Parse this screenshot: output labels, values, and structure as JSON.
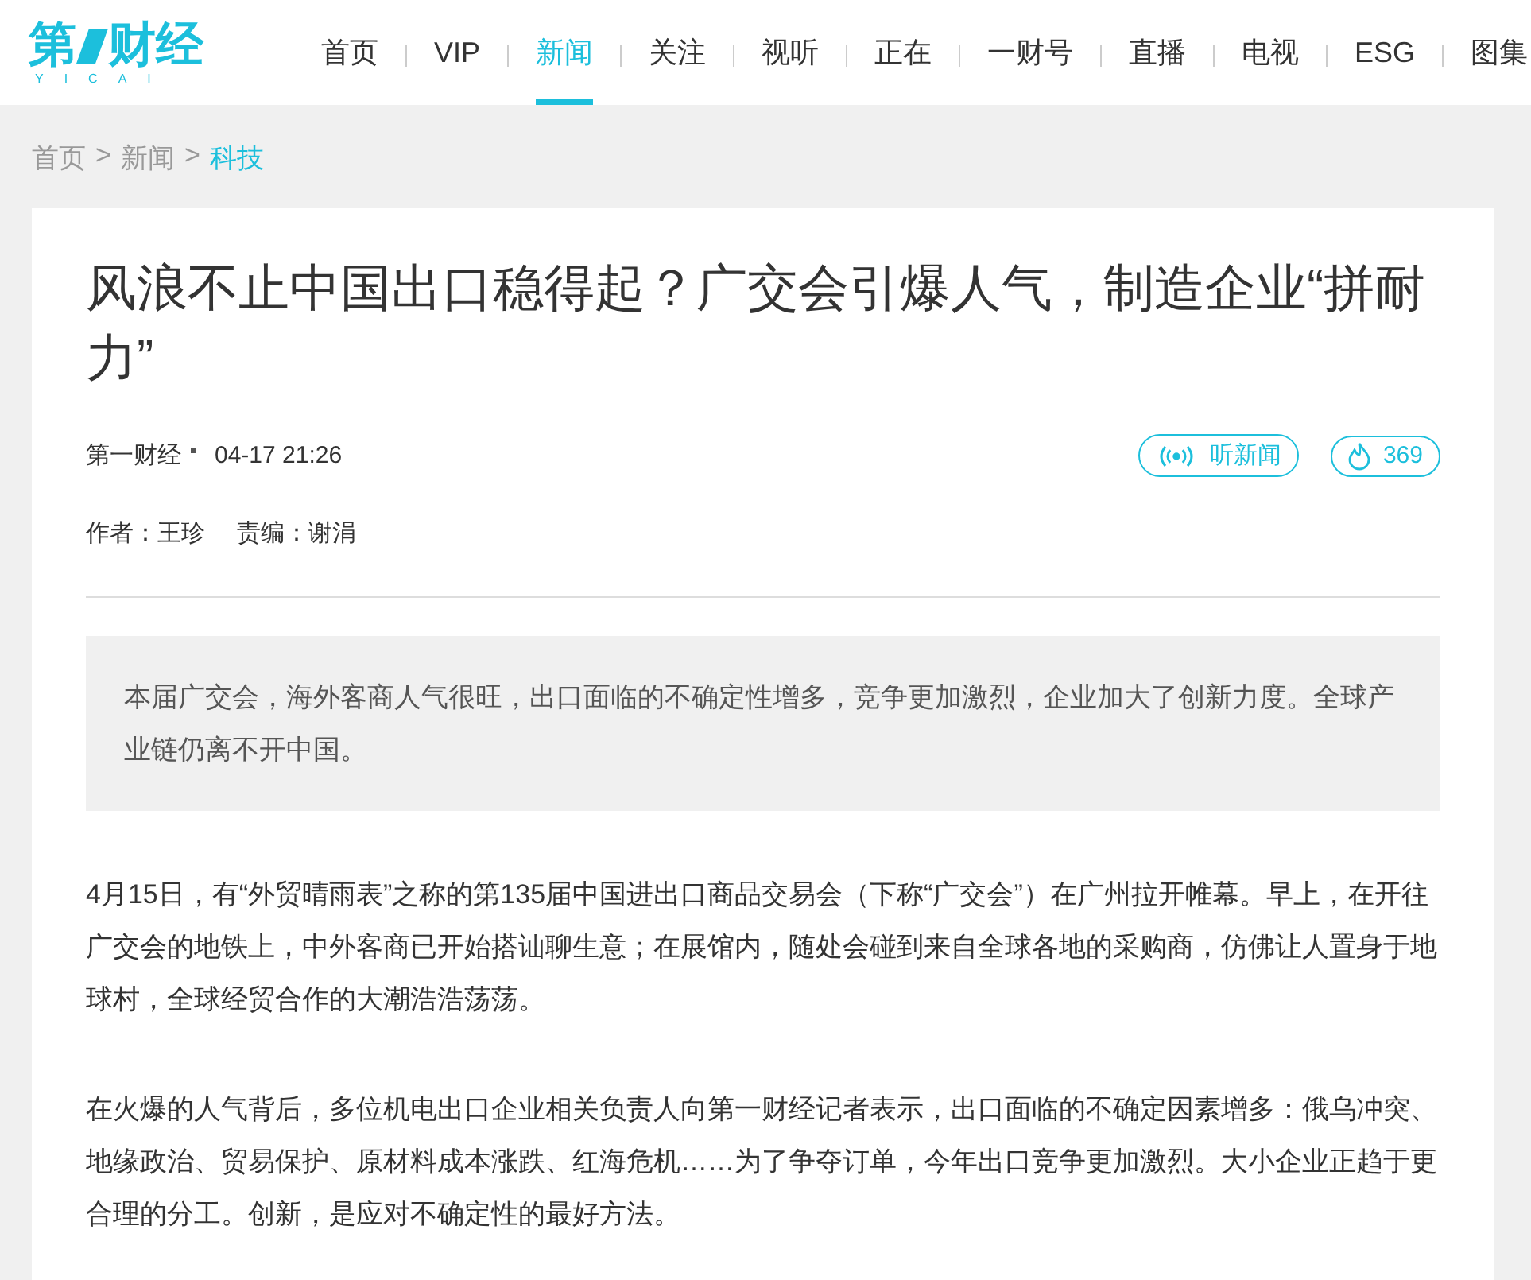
{
  "logo": {
    "first": "第",
    "rest": "财经",
    "subtitle": "YICAI"
  },
  "nav": [
    {
      "label": "首页",
      "selected": false
    },
    {
      "label": "VIP",
      "selected": false
    },
    {
      "label": "新闻",
      "selected": true
    },
    {
      "label": "关注",
      "selected": false
    },
    {
      "label": "视听",
      "selected": false
    },
    {
      "label": "正在",
      "selected": false
    },
    {
      "label": "一财号",
      "selected": false
    },
    {
      "label": "直播",
      "selected": false
    },
    {
      "label": "电视",
      "selected": false
    },
    {
      "label": "ESG",
      "selected": false
    },
    {
      "label": "图集",
      "selected": false
    }
  ],
  "breadcrumb": [
    {
      "label": "首页",
      "selected": false
    },
    {
      "label": "新闻",
      "selected": false
    },
    {
      "label": "科技",
      "selected": true
    }
  ],
  "breadcrumb_separator": ">",
  "article": {
    "title": "风浪不止中国出口稳得起？广交会引爆人气，制造企业“拼耐力”",
    "source": "第一财经",
    "time": "04-17 21:26",
    "listen_label": "听新闻",
    "heat": "369",
    "author": "作者：王珍",
    "editor": "责编：谢涓",
    "summary": "本届广交会，海外客商人气很旺，出口面临的不确定性增多，竞争更加激烈，企业加大了创新力度。全球产业链仍离不开中国。",
    "paragraphs": [
      "4月15日，有“外贸晴雨表”之称的第135届中国进出口商品交易会（下称“广交会”）在广州拉开帷幕。早上，在开往广交会的地铁上，中外客商已开始搭讪聊生意；在展馆内，随处会碰到来自全球各地的采购商，仿佛让人置身于地球村，全球经贸合作的大潮浩浩荡荡。",
      "在火爆的人气背后，多位机电出口企业相关负责人向第一财经记者表示，出口面临的不确定因素增多：俄乌冲突、地缘政治、贸易保护、原材料成本涨跌、红海危机……为了争夺订单，今年出口竞争更加激烈。大小企业正趋于更合理的分工。创新，是应对不确定性的最好方法。"
    ]
  }
}
